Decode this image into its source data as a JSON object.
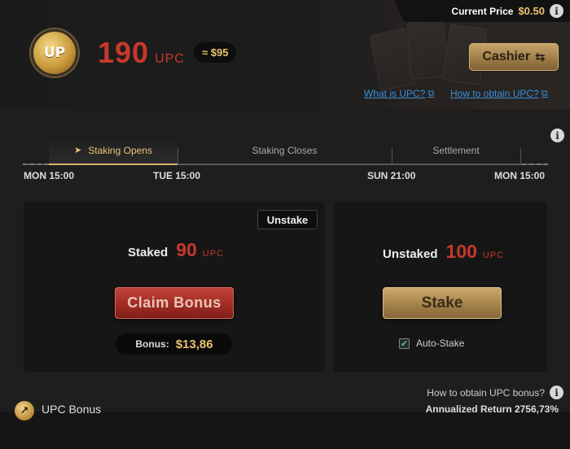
{
  "header": {
    "current_price_label": "Current Price",
    "current_price_value": "$0.50",
    "logo_text": "UP",
    "balance_value": "190",
    "balance_unit": "UPC",
    "balance_usd": "≈ $95",
    "cashier_label": "Cashier",
    "links": [
      {
        "label": "What is UPC?"
      },
      {
        "label": "How to obtain UPC?"
      }
    ]
  },
  "timeline": {
    "phases": [
      "Staking Opens",
      "Staking Closes",
      "Settlement"
    ],
    "dates": [
      "MON 15:00",
      "TUE 15:00",
      "SUN 21:00",
      "MON 15:00"
    ]
  },
  "staked_panel": {
    "unstake_label": "Unstake",
    "label": "Staked",
    "value": "90",
    "unit": "UPC",
    "claim_label": "Claim Bonus",
    "bonus_label": "Bonus:",
    "bonus_value": "$13,86"
  },
  "unstaked_panel": {
    "label": "Unstaked",
    "value": "100",
    "unit": "UPC",
    "stake_label": "Stake",
    "auto_stake_label": "Auto-Stake",
    "auto_stake_checked": true
  },
  "how_bonus_label": "How to obtain UPC bonus?",
  "footer": {
    "title": "UPC Bonus",
    "annualized_return": "Annualized Return 2756,73%"
  },
  "colors": {
    "accent_red": "#c7382c",
    "accent_gold": "#e8c370",
    "link_blue": "#3a8fd8"
  },
  "icons": [
    "info-icon",
    "up-coin-logo",
    "swap-arrows-icon",
    "external-link-icon",
    "flag-icon",
    "check-icon",
    "chart-up-icon"
  ]
}
